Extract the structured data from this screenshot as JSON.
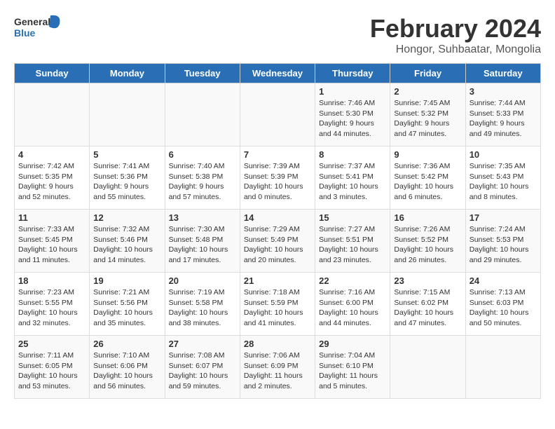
{
  "header": {
    "logo_general": "General",
    "logo_blue": "Blue",
    "month": "February 2024",
    "location": "Hongor, Suhbaatar, Mongolia"
  },
  "weekdays": [
    "Sunday",
    "Monday",
    "Tuesday",
    "Wednesday",
    "Thursday",
    "Friday",
    "Saturday"
  ],
  "weeks": [
    [
      {
        "day": "",
        "info": ""
      },
      {
        "day": "",
        "info": ""
      },
      {
        "day": "",
        "info": ""
      },
      {
        "day": "",
        "info": ""
      },
      {
        "day": "1",
        "info": "Sunrise: 7:46 AM\nSunset: 5:30 PM\nDaylight: 9 hours and 44 minutes."
      },
      {
        "day": "2",
        "info": "Sunrise: 7:45 AM\nSunset: 5:32 PM\nDaylight: 9 hours and 47 minutes."
      },
      {
        "day": "3",
        "info": "Sunrise: 7:44 AM\nSunset: 5:33 PM\nDaylight: 9 hours and 49 minutes."
      }
    ],
    [
      {
        "day": "4",
        "info": "Sunrise: 7:42 AM\nSunset: 5:35 PM\nDaylight: 9 hours and 52 minutes."
      },
      {
        "day": "5",
        "info": "Sunrise: 7:41 AM\nSunset: 5:36 PM\nDaylight: 9 hours and 55 minutes."
      },
      {
        "day": "6",
        "info": "Sunrise: 7:40 AM\nSunset: 5:38 PM\nDaylight: 9 hours and 57 minutes."
      },
      {
        "day": "7",
        "info": "Sunrise: 7:39 AM\nSunset: 5:39 PM\nDaylight: 10 hours and 0 minutes."
      },
      {
        "day": "8",
        "info": "Sunrise: 7:37 AM\nSunset: 5:41 PM\nDaylight: 10 hours and 3 minutes."
      },
      {
        "day": "9",
        "info": "Sunrise: 7:36 AM\nSunset: 5:42 PM\nDaylight: 10 hours and 6 minutes."
      },
      {
        "day": "10",
        "info": "Sunrise: 7:35 AM\nSunset: 5:43 PM\nDaylight: 10 hours and 8 minutes."
      }
    ],
    [
      {
        "day": "11",
        "info": "Sunrise: 7:33 AM\nSunset: 5:45 PM\nDaylight: 10 hours and 11 minutes."
      },
      {
        "day": "12",
        "info": "Sunrise: 7:32 AM\nSunset: 5:46 PM\nDaylight: 10 hours and 14 minutes."
      },
      {
        "day": "13",
        "info": "Sunrise: 7:30 AM\nSunset: 5:48 PM\nDaylight: 10 hours and 17 minutes."
      },
      {
        "day": "14",
        "info": "Sunrise: 7:29 AM\nSunset: 5:49 PM\nDaylight: 10 hours and 20 minutes."
      },
      {
        "day": "15",
        "info": "Sunrise: 7:27 AM\nSunset: 5:51 PM\nDaylight: 10 hours and 23 minutes."
      },
      {
        "day": "16",
        "info": "Sunrise: 7:26 AM\nSunset: 5:52 PM\nDaylight: 10 hours and 26 minutes."
      },
      {
        "day": "17",
        "info": "Sunrise: 7:24 AM\nSunset: 5:53 PM\nDaylight: 10 hours and 29 minutes."
      }
    ],
    [
      {
        "day": "18",
        "info": "Sunrise: 7:23 AM\nSunset: 5:55 PM\nDaylight: 10 hours and 32 minutes."
      },
      {
        "day": "19",
        "info": "Sunrise: 7:21 AM\nSunset: 5:56 PM\nDaylight: 10 hours and 35 minutes."
      },
      {
        "day": "20",
        "info": "Sunrise: 7:19 AM\nSunset: 5:58 PM\nDaylight: 10 hours and 38 minutes."
      },
      {
        "day": "21",
        "info": "Sunrise: 7:18 AM\nSunset: 5:59 PM\nDaylight: 10 hours and 41 minutes."
      },
      {
        "day": "22",
        "info": "Sunrise: 7:16 AM\nSunset: 6:00 PM\nDaylight: 10 hours and 44 minutes."
      },
      {
        "day": "23",
        "info": "Sunrise: 7:15 AM\nSunset: 6:02 PM\nDaylight: 10 hours and 47 minutes."
      },
      {
        "day": "24",
        "info": "Sunrise: 7:13 AM\nSunset: 6:03 PM\nDaylight: 10 hours and 50 minutes."
      }
    ],
    [
      {
        "day": "25",
        "info": "Sunrise: 7:11 AM\nSunset: 6:05 PM\nDaylight: 10 hours and 53 minutes."
      },
      {
        "day": "26",
        "info": "Sunrise: 7:10 AM\nSunset: 6:06 PM\nDaylight: 10 hours and 56 minutes."
      },
      {
        "day": "27",
        "info": "Sunrise: 7:08 AM\nSunset: 6:07 PM\nDaylight: 10 hours and 59 minutes."
      },
      {
        "day": "28",
        "info": "Sunrise: 7:06 AM\nSunset: 6:09 PM\nDaylight: 11 hours and 2 minutes."
      },
      {
        "day": "29",
        "info": "Sunrise: 7:04 AM\nSunset: 6:10 PM\nDaylight: 11 hours and 5 minutes."
      },
      {
        "day": "",
        "info": ""
      },
      {
        "day": "",
        "info": ""
      }
    ]
  ]
}
